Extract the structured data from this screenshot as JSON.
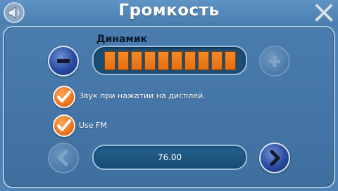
{
  "header": {
    "title": "Громкость",
    "left_icon": "speaker-icon",
    "right_icon": "close-icon"
  },
  "volume": {
    "label": "Динамик",
    "level_segments": 10,
    "max_segments": 10,
    "decrease_icon": "minus-icon",
    "increase_icon": "plus-icon",
    "increase_enabled": false
  },
  "options": [
    {
      "label": "Звук при нажатии на дисплей.",
      "checked": true
    },
    {
      "label": "Use FM",
      "checked": true
    }
  ],
  "fm": {
    "frequency": "76.00",
    "prev_icon": "chevron-left-icon",
    "next_icon": "chevron-right-icon",
    "prev_enabled": false
  },
  "colors": {
    "background": "#4f82b4",
    "accent_orange": "#f07a20",
    "button_blue": "#2a4aa0",
    "track": "#1c4d73"
  }
}
